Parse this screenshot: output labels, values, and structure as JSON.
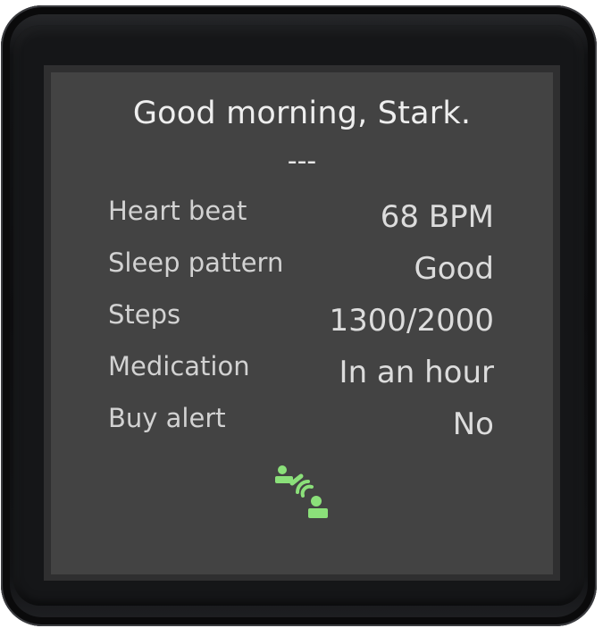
{
  "greeting": "Good morning, Stark.",
  "separator": "---",
  "stats": [
    {
      "label": "Heart beat",
      "value": "68 BPM"
    },
    {
      "label": "Sleep pattern",
      "value": "Good"
    },
    {
      "label": "Steps",
      "value": "1300/2000"
    },
    {
      "label": "Medication",
      "value": "In an hour"
    },
    {
      "label": "Buy alert",
      "value": "No"
    }
  ],
  "action": {
    "icon": "voice-call-icon",
    "color": "#8be07a"
  },
  "colors": {
    "screen_background": "#434343",
    "text": "#dcdcdc",
    "accent": "#8be07a"
  }
}
